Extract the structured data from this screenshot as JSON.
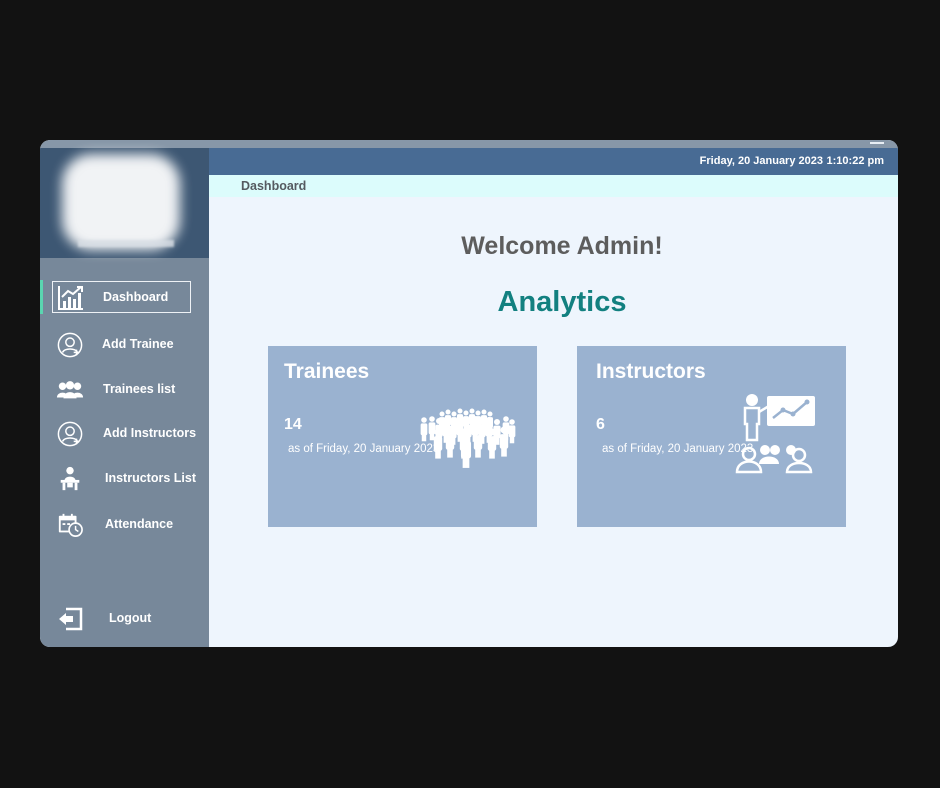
{
  "header": {
    "date": "Friday, 20 January 2023",
    "time": "1:10:22 pm"
  },
  "breadcrumb": "Dashboard",
  "sidebar": {
    "items": [
      {
        "label": "Dashboard",
        "icon": "chart-growth-icon"
      },
      {
        "label": "Add Trainee",
        "icon": "add-user-icon"
      },
      {
        "label": "Trainees list",
        "icon": "group-icon"
      },
      {
        "label": "Add Instructors",
        "icon": "add-user-icon"
      },
      {
        "label": "Instructors List",
        "icon": "presenter-icon"
      },
      {
        "label": "Attendance",
        "icon": "calendar-clock-icon"
      }
    ],
    "logout_label": "Logout",
    "active_index": 0
  },
  "main": {
    "welcome": "Welcome Admin!",
    "analytics_title": "Analytics",
    "cards": [
      {
        "title": "Trainees",
        "count": "14",
        "as_of": "as of Friday, 20 January 2023",
        "icon": "crowd-icon"
      },
      {
        "title": "Instructors",
        "count": "6",
        "as_of": "as of Friday, 20 January 2023",
        "icon": "presentation-icon"
      }
    ]
  },
  "colors": {
    "sidebar": "#77889a",
    "topbar": "#486b94",
    "accent": "#128080",
    "card": "#9ab2d0",
    "crumb": "#dcfcfc",
    "active_marker": "#5ad6b0"
  }
}
